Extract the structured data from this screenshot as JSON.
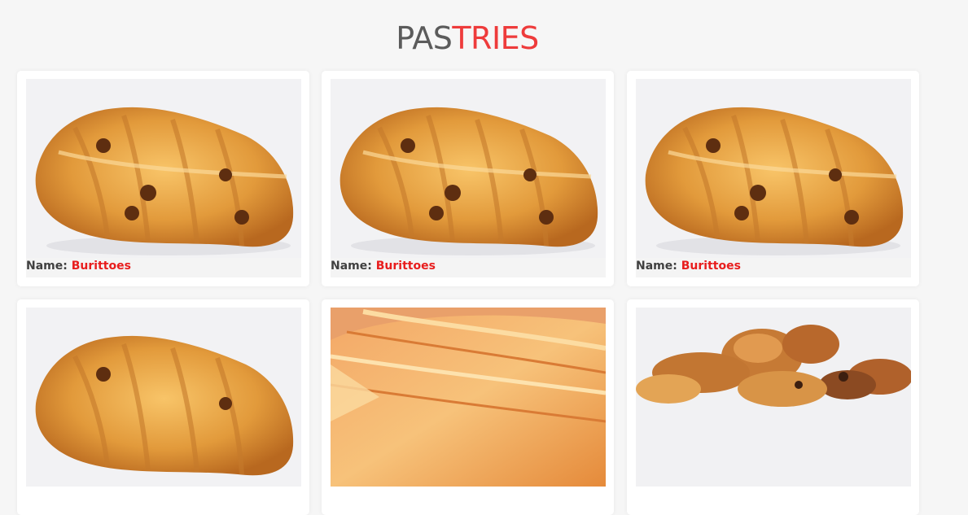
{
  "page": {
    "title_left": "PAS",
    "title_right": "TRIES"
  },
  "cards": [
    {
      "image_icon": "braided-danish-pastry-image",
      "label": "Name:",
      "value": "Burittoes"
    },
    {
      "image_icon": "braided-danish-pastry-image",
      "label": "Name:",
      "value": "Burittoes"
    },
    {
      "image_icon": "braided-danish-pastry-image",
      "label": "Name:",
      "value": "Burittoes"
    },
    {
      "image_icon": "braided-danish-pastry-image"
    },
    {
      "image_icon": "flaky-pastry-sheets-image"
    },
    {
      "image_icon": "croissant-basket-image"
    }
  ]
}
